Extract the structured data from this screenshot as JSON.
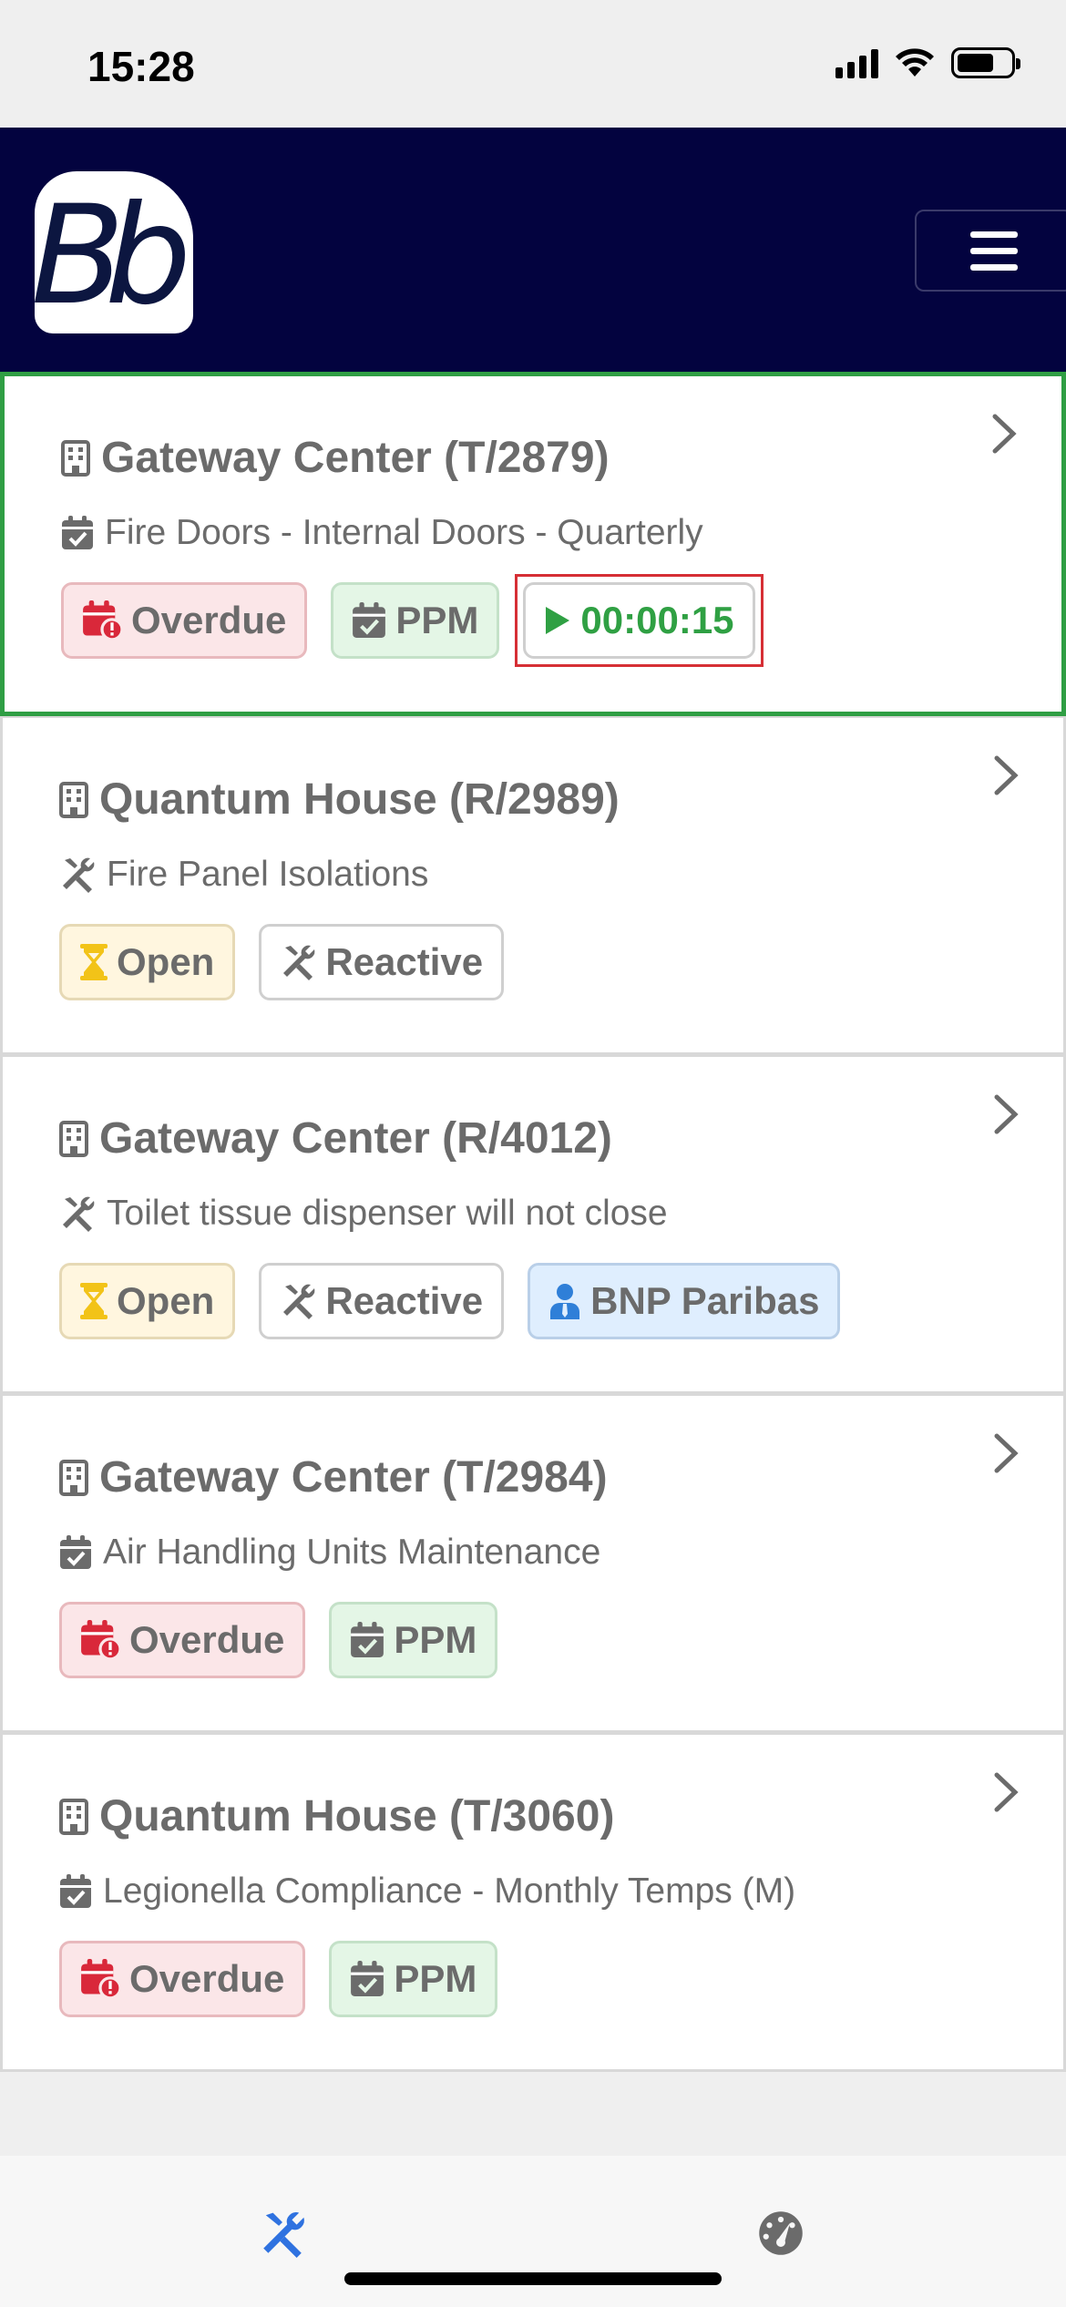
{
  "status_bar": {
    "time": "15:28"
  },
  "header": {
    "logo_text": "Bb"
  },
  "jobs": [
    {
      "title": "Gateway Center (T/2879)",
      "description": "Fire Doors - Internal Doors - Quarterly",
      "badges": [
        "Overdue",
        "PPM"
      ],
      "timer": "00:00:15"
    },
    {
      "title": "Quantum House (R/2989)",
      "description": "Fire Panel Isolations",
      "badges": [
        "Open",
        "Reactive"
      ]
    },
    {
      "title": "Gateway Center (R/4012)",
      "description": "Toilet tissue dispenser will not close",
      "badges": [
        "Open",
        "Reactive",
        "BNP Paribas"
      ]
    },
    {
      "title": "Gateway Center (T/2984)",
      "description": "Air Handling Units Maintenance",
      "badges": [
        "Overdue",
        "PPM"
      ]
    },
    {
      "title": "Quantum House (T/3060)",
      "description": "Legionella Compliance - Monthly Temps (M)",
      "badges": [
        "Overdue",
        "PPM"
      ]
    }
  ],
  "colors": {
    "header_bg": "#03033f",
    "selected_border": "#2f9e44",
    "timer_highlight": "#d62f35",
    "overdue": "#d9283a",
    "ppm": "#6b6b6b",
    "open": "#f2c318",
    "client": "#2f7fd8",
    "active_nav": "#2f72e0"
  },
  "icons": {
    "building": "building-icon",
    "calendar": "calendar-check-icon",
    "tools": "tools-icon",
    "hourglass": "hourglass-icon",
    "user": "user-tie-icon",
    "play": "play-icon",
    "chevron": "chevron-right-icon",
    "dashboard": "gauge-icon"
  }
}
